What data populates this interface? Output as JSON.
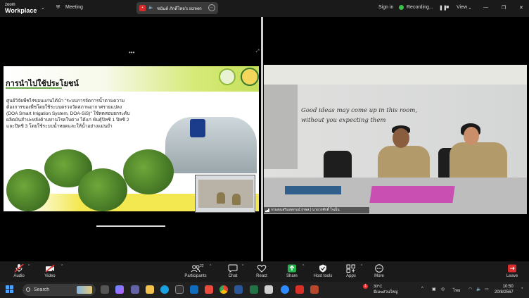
{
  "titlebar": {
    "logo_line1": "zoom",
    "logo_line2": "Workplace",
    "meeting_label": "Meeting",
    "share_label": "ชนันต์ ภักดีไทย's screen",
    "sign_in": "Sign in",
    "recording": "Recording...",
    "view": "View"
  },
  "slide": {
    "title": "การนำไปใช้ประโยชน์",
    "body": "ศูนย์วิจัยพืชไร่ขอนแก่นได้นำ \"ระบบการจัดการน้ำตามความต้องการของพืชโดยใช้ระบบตรวจวัดสภาพอากาศรายแปลง (DOA Smart Irrigation System, DOA-SiS)\" ใช้ทดสอบยกระดับผลิตมันสำปะหลังด้านทานโรคใบด่าง ได้แก่ พันธุ์ปิหชิ 1 ปิหชิ 2 และปิหชิ 3 โดยใช้ระบบน้ำหยดและให้น้ำอย่างแม่นยำ"
  },
  "camera": {
    "wall_text_line1": "Good ideas may come up in this room,",
    "wall_text_line2": "without you expecting them",
    "name_tag": "กรมส่งเสริมสหกรณ์ (กพส.) นายวรศักดิ์ ใจเย็น"
  },
  "toolbar": {
    "audio": "Audio",
    "video": "Video",
    "participants": "Participants",
    "participants_count": "22",
    "chat": "Chat",
    "react": "React",
    "share": "Share",
    "host_tools": "Host tools",
    "apps": "Apps",
    "more": "More",
    "leave": "Leave"
  },
  "taskbar": {
    "search_placeholder": "Search",
    "weather_temp": "30°C",
    "weather_desc": "มีเมฆส่วนใหญ่",
    "weather_badge": "1",
    "lang": "ไทย",
    "time": "10:50",
    "date": "20/8/2567"
  },
  "colors": {
    "accent_green": "#3ac24a",
    "leave_red": "#d92d2d",
    "share_green": "#22b14c"
  }
}
